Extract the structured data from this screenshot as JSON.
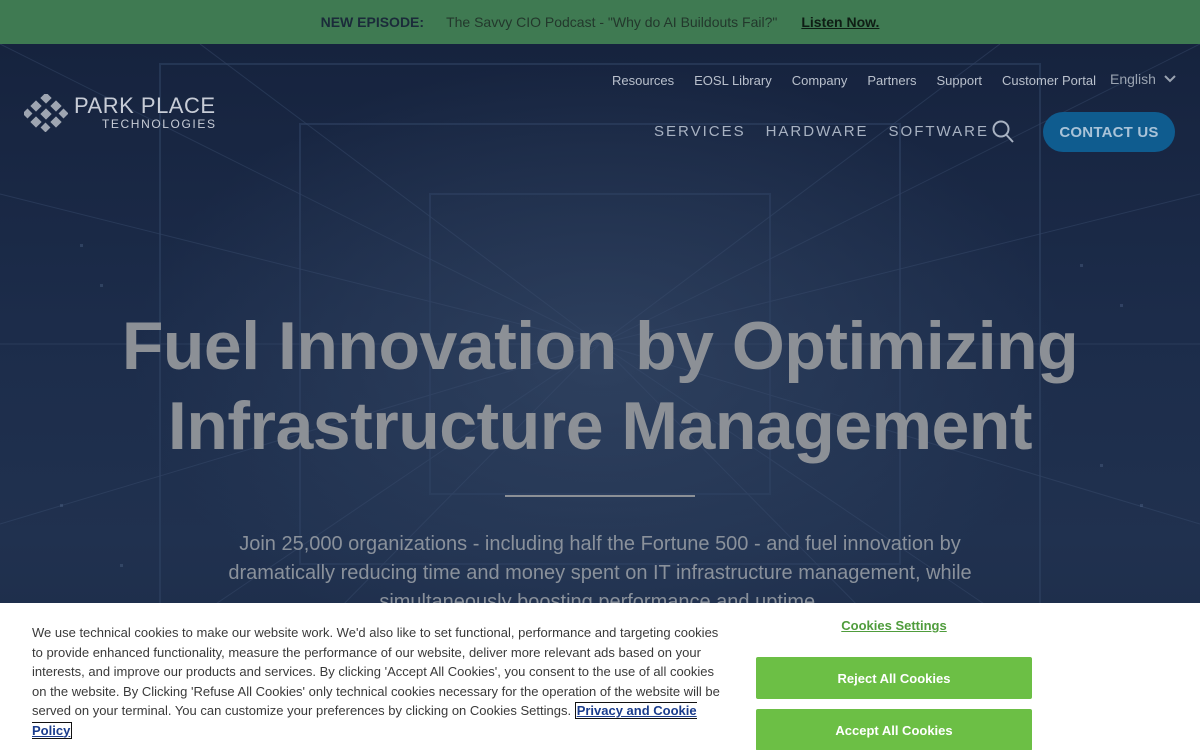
{
  "announcement": {
    "tag": "NEW EPISODE:",
    "text": "The Savvy CIO Podcast - \"Why do AI Buildouts Fail?\"",
    "link": "Listen Now."
  },
  "logo": {
    "line1": "PARK PLACE",
    "line2": "TECHNOLOGIES"
  },
  "utility_nav": [
    "Resources",
    "EOSL Library",
    "Company",
    "Partners",
    "Support",
    "Customer Portal"
  ],
  "language": "English",
  "main_nav": [
    "SERVICES",
    "HARDWARE",
    "SOFTWARE"
  ],
  "contact_button": "CONTACT US",
  "hero": {
    "title_line1": "Fuel Innovation by Optimizing",
    "title_line2": "Infrastructure Management",
    "subtitle": "Join 25,000 organizations - including half the Fortune 500 - and fuel innovation by dramatically reducing time and money spent on IT infrastructure management, while simultaneously boosting performance and uptime."
  },
  "cookie": {
    "text": "We use technical cookies to make our website work. We'd also like to set functional, performance and targeting cookies to provide enhanced functionality, measure the performance of our website, deliver more relevant ads based on your interests, and improve our products and services. By clicking 'Accept All Cookies', you consent to the use of all cookies on the website. By Clicking 'Refuse All Cookies' only technical cookies necessary for the operation of the website will be served on your terminal. You can customize your preferences by clicking on Cookies Settings.",
    "policy_link": "Privacy and Cookie Policy",
    "settings_link": "Cookies Settings",
    "reject_button": "Reject All Cookies",
    "accept_button": "Accept All Cookies"
  },
  "colors": {
    "announcement_bg": "#3f7a52",
    "contact_bg": "#0f5c8f",
    "cookie_button": "#6cbf45"
  },
  "icons": [
    "logo-mark-icon",
    "chevron-down-icon",
    "search-icon"
  ]
}
